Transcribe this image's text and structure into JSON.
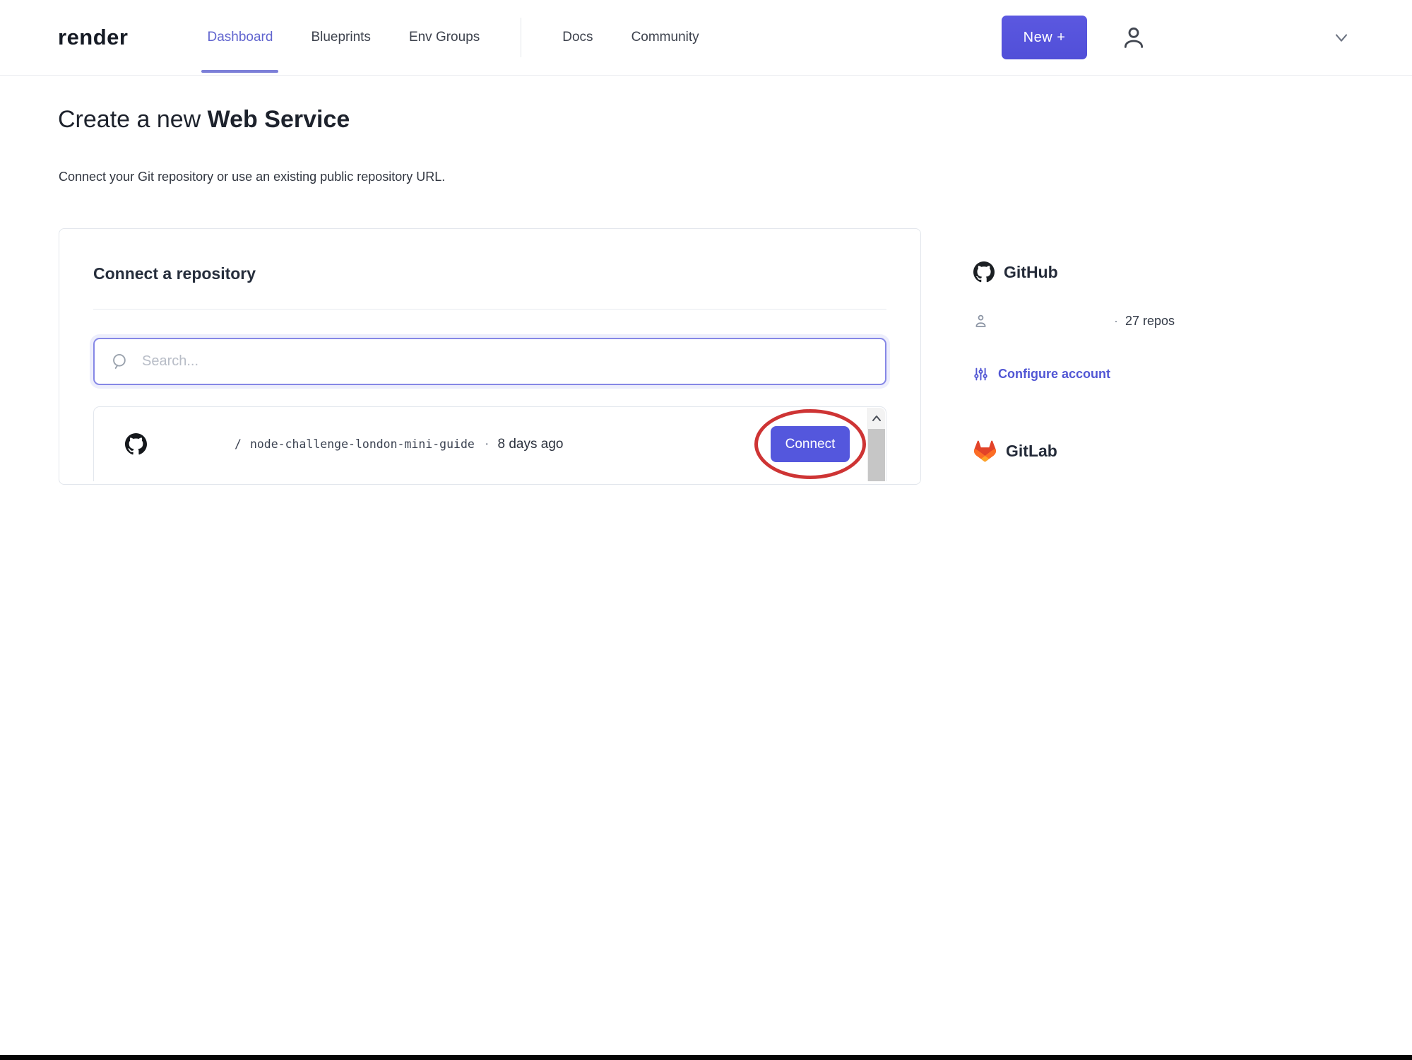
{
  "nav": {
    "logo": "render",
    "items": [
      {
        "label": "Dashboard",
        "active": true
      },
      {
        "label": "Blueprints",
        "active": false
      },
      {
        "label": "Env Groups",
        "active": false
      },
      {
        "label": "Docs",
        "active": false
      },
      {
        "label": "Community",
        "active": false
      }
    ],
    "new_button_label": "New +"
  },
  "page": {
    "title_prefix": "Create a new ",
    "title_emphasis": "Web Service",
    "subtitle": "Connect your Git repository or use an existing public repository URL."
  },
  "card": {
    "heading": "Connect a repository",
    "search": {
      "placeholder": "Search..."
    },
    "repo": {
      "path_separator": "/",
      "name": "node-challenge-london-mini-guide",
      "dot": "·",
      "updated": "8 days ago",
      "connect_label": "Connect"
    }
  },
  "sidebar": {
    "github": {
      "title": "GitHub",
      "dot": "·",
      "repos_count": "27 repos",
      "configure_label": "Configure account"
    },
    "gitlab": {
      "title": "GitLab"
    }
  },
  "colors": {
    "accent_purple": "#5457dd",
    "active_tab_purple": "#6165cf",
    "link_purple": "#5156d4",
    "annotation_red": "#ce3434",
    "github_black": "#1b1f23",
    "gitlab_orange": "#e24329",
    "gitlab_mid_orange": "#fc6d26",
    "gitlab_yellow": "#fca326"
  }
}
